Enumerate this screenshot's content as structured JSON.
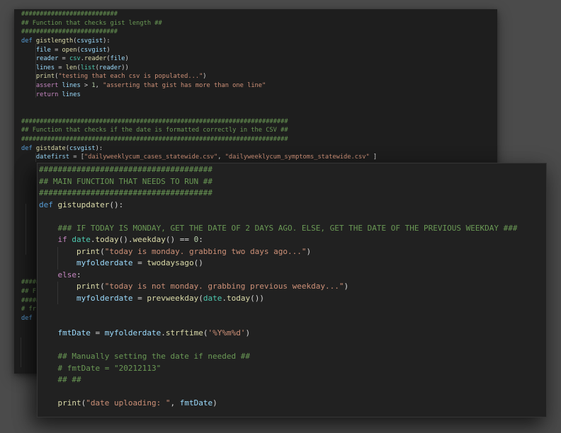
{
  "window": {
    "desktop_background": "#4b4b4b",
    "back_panel_background": "#1e1e1e",
    "front_panel_background": "#212121"
  },
  "palette": {
    "cm": "#6A9955",
    "kw": "#569CD6",
    "ctrl": "#C586C0",
    "fn": "#DCDCAA",
    "var": "#9CDCFE",
    "str": "#CE9178",
    "num": "#B5CEA8",
    "pun": "#D4D4D4",
    "cls": "#4EC9B0"
  },
  "panels": [
    {
      "name": "back-code",
      "lines": [
        [
          [
            "cm",
            "##########################"
          ]
        ],
        [
          [
            "cm",
            "## Function that checks gist length ##"
          ]
        ],
        [
          [
            "cm",
            "##########################"
          ]
        ],
        [
          [
            "kw",
            "def "
          ],
          [
            "fn",
            "gistlength"
          ],
          [
            "pun",
            "("
          ],
          [
            "var",
            "csvgist"
          ],
          [
            "pun",
            "):"
          ]
        ],
        [
          [
            "pun",
            "    "
          ],
          [
            "var",
            "file"
          ],
          [
            "pun",
            " = "
          ],
          [
            "fn",
            "open"
          ],
          [
            "pun",
            "("
          ],
          [
            "var",
            "csvgist"
          ],
          [
            "pun",
            ")"
          ]
        ],
        [
          [
            "pun",
            "    "
          ],
          [
            "var",
            "reader"
          ],
          [
            "pun",
            " = "
          ],
          [
            "cls",
            "csv"
          ],
          [
            "pun",
            "."
          ],
          [
            "fn",
            "reader"
          ],
          [
            "pun",
            "("
          ],
          [
            "var",
            "file"
          ],
          [
            "pun",
            ")"
          ]
        ],
        [
          [
            "pun",
            "    "
          ],
          [
            "var",
            "lines"
          ],
          [
            "pun",
            " = "
          ],
          [
            "fn",
            "len"
          ],
          [
            "pun",
            "("
          ],
          [
            "cls",
            "list"
          ],
          [
            "pun",
            "("
          ],
          [
            "var",
            "reader"
          ],
          [
            "pun",
            "))"
          ]
        ],
        [
          [
            "pun",
            "    "
          ],
          [
            "fn",
            "print"
          ],
          [
            "pun",
            "("
          ],
          [
            "str",
            "\"testing that each csv is populated...\""
          ],
          [
            "pun",
            ")"
          ]
        ],
        [
          [
            "pun",
            "    "
          ],
          [
            "ctrl",
            "assert"
          ],
          [
            "var",
            " lines"
          ],
          [
            "pun",
            " > "
          ],
          [
            "num",
            "1"
          ],
          [
            "pun",
            ", "
          ],
          [
            "str",
            "\"asserting that gist has more than one line\""
          ]
        ],
        [
          [
            "pun",
            "    "
          ],
          [
            "ctrl",
            "return"
          ],
          [
            "var",
            " lines"
          ]
        ],
        [],
        [],
        [
          [
            "cm",
            "########################################################################"
          ]
        ],
        [
          [
            "cm",
            "## Function that checks if the date is formatted correctly in the CSV ##"
          ]
        ],
        [
          [
            "cm",
            "########################################################################"
          ]
        ],
        [
          [
            "kw",
            "def "
          ],
          [
            "fn",
            "gistdate"
          ],
          [
            "pun",
            "("
          ],
          [
            "var",
            "csvgist"
          ],
          [
            "pun",
            "):"
          ]
        ],
        [
          [
            "pun",
            "    "
          ],
          [
            "var",
            "datefirst"
          ],
          [
            "pun",
            " = ["
          ],
          [
            "str",
            "\"dailyweeklycum_cases_statewide.csv\""
          ],
          [
            "pun",
            ", "
          ],
          [
            "str",
            "\"dailyweeklycum_symptoms_statewide.csv\""
          ],
          [
            "pun",
            " ]"
          ]
        ],
        [],
        [],
        [],
        [],
        [],
        [],
        [],
        [],
        [],
        [],
        [],
        [],
        [],
        [
          [
            "cm",
            "#####"
          ]
        ],
        [
          [
            "cm",
            "## F"
          ]
        ],
        [
          [
            "cm",
            "#####"
          ]
        ],
        [
          [
            "cm",
            "# fr"
          ]
        ],
        [
          [
            "kw",
            "def"
          ]
        ]
      ]
    },
    {
      "name": "front-code",
      "lines": [
        [
          [
            "cm",
            "#####################################"
          ]
        ],
        [
          [
            "cm",
            "## MAIN FUNCTION THAT NEEDS TO RUN ##"
          ]
        ],
        [
          [
            "cm",
            "#####################################"
          ]
        ],
        [
          [
            "kw",
            "def "
          ],
          [
            "fn",
            "gistupdater"
          ],
          [
            "pun",
            "():"
          ]
        ],
        [],
        [
          [
            "pun",
            "    "
          ],
          [
            "cm",
            "### IF TODAY IS MONDAY, GET THE DATE OF 2 DAYS AGO. ELSE, GET THE DATE OF THE PREVIOUS WEEKDAY ###"
          ]
        ],
        [
          [
            "pun",
            "    "
          ],
          [
            "ctrl",
            "if "
          ],
          [
            "cls",
            "date"
          ],
          [
            "pun",
            "."
          ],
          [
            "fn",
            "today"
          ],
          [
            "pun",
            "()."
          ],
          [
            "fn",
            "weekday"
          ],
          [
            "pun",
            "() == "
          ],
          [
            "num",
            "0"
          ],
          [
            "pun",
            ":"
          ]
        ],
        [
          [
            "pun",
            "        "
          ],
          [
            "fn",
            "print"
          ],
          [
            "pun",
            "("
          ],
          [
            "str",
            "\"today is monday. grabbing two days ago...\""
          ],
          [
            "pun",
            ")"
          ]
        ],
        [
          [
            "pun",
            "        "
          ],
          [
            "var",
            "myfolderdate"
          ],
          [
            "pun",
            " = "
          ],
          [
            "fn",
            "twodaysago"
          ],
          [
            "pun",
            "()"
          ]
        ],
        [
          [
            "pun",
            "    "
          ],
          [
            "ctrl",
            "else"
          ],
          [
            "pun",
            ":"
          ]
        ],
        [
          [
            "pun",
            "        "
          ],
          [
            "fn",
            "print"
          ],
          [
            "pun",
            "("
          ],
          [
            "str",
            "\"today is not monday. grabbing previous weekday...\""
          ],
          [
            "pun",
            ")"
          ]
        ],
        [
          [
            "pun",
            "        "
          ],
          [
            "var",
            "myfolderdate"
          ],
          [
            "pun",
            " = "
          ],
          [
            "fn",
            "prevweekday"
          ],
          [
            "pun",
            "("
          ],
          [
            "cls",
            "date"
          ],
          [
            "pun",
            "."
          ],
          [
            "fn",
            "today"
          ],
          [
            "pun",
            "())"
          ]
        ],
        [],
        [],
        [
          [
            "pun",
            "    "
          ],
          [
            "var",
            "fmtDate"
          ],
          [
            "pun",
            " = "
          ],
          [
            "var",
            "myfolderdate"
          ],
          [
            "pun",
            "."
          ],
          [
            "fn",
            "strftime"
          ],
          [
            "pun",
            "("
          ],
          [
            "str",
            "'%Y%m%d'"
          ],
          [
            "pun",
            ")"
          ]
        ],
        [],
        [
          [
            "pun",
            "    "
          ],
          [
            "cm",
            "## Manually setting the date if needed ##"
          ]
        ],
        [
          [
            "pun",
            "    "
          ],
          [
            "cm",
            "# fmtDate = \"20212113\""
          ]
        ],
        [
          [
            "pun",
            "    "
          ],
          [
            "cm",
            "## ##"
          ]
        ],
        [],
        [
          [
            "pun",
            "    "
          ],
          [
            "fn",
            "print"
          ],
          [
            "pun",
            "("
          ],
          [
            "str",
            "\"date uploading: \""
          ],
          [
            "pun",
            ", "
          ],
          [
            "var",
            "fmtDate"
          ],
          [
            "pun",
            ")"
          ]
        ]
      ]
    }
  ]
}
